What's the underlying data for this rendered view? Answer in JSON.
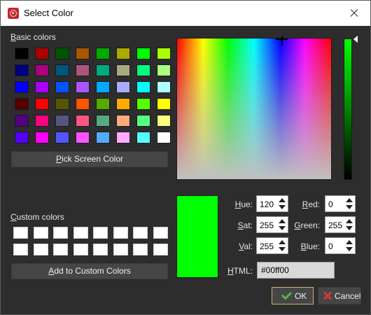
{
  "window": {
    "title": "Select Color"
  },
  "basic_colors": {
    "label": "Basic colors",
    "swatches": [
      [
        "#000000",
        "#aa0000",
        "#005500",
        "#aa5500",
        "#00aa00",
        "#aaaa00",
        "#00ff00",
        "#aaff00"
      ],
      [
        "#00007f",
        "#aa007f",
        "#00557f",
        "#aa557f",
        "#00aa7f",
        "#aaaa7f",
        "#00ff7f",
        "#aaff7f"
      ],
      [
        "#0000ff",
        "#aa00ff",
        "#0055ff",
        "#aa55ff",
        "#00aaff",
        "#aaaaff",
        "#00ffff",
        "#aaffff"
      ],
      [
        "#550000",
        "#ff0000",
        "#555500",
        "#ff5500",
        "#55aa00",
        "#ffaa00",
        "#55ff00",
        "#ffff00"
      ],
      [
        "#55007f",
        "#ff007f",
        "#55557f",
        "#ff557f",
        "#55aa7f",
        "#ffaa7f",
        "#55ff7f",
        "#ffff7f"
      ],
      [
        "#5500ff",
        "#ff00ff",
        "#5555ff",
        "#ff55ff",
        "#55aaff",
        "#ffaaff",
        "#55ffff",
        "#ffffff"
      ]
    ]
  },
  "pick_screen_color_label": "Pick Screen Color",
  "custom_colors": {
    "label": "Custom colors",
    "swatches": [
      [
        "#ffffff",
        "#ffffff",
        "#ffffff",
        "#ffffff",
        "#ffffff",
        "#ffffff",
        "#ffffff",
        "#ffffff"
      ],
      [
        "#ffffff",
        "#ffffff",
        "#ffffff",
        "#ffffff",
        "#ffffff",
        "#ffffff",
        "#ffffff",
        "#ffffff"
      ]
    ]
  },
  "add_custom_label": "Add to Custom Colors",
  "fields": {
    "hue": {
      "label": "Hue:",
      "value": "120"
    },
    "sat": {
      "label": "Sat:",
      "value": "255"
    },
    "val": {
      "label": "Val:",
      "value": "255"
    },
    "red": {
      "label": "Red:",
      "value": "0"
    },
    "green": {
      "label": "Green:",
      "value": "255"
    },
    "blue": {
      "label": "Blue:",
      "value": "0"
    },
    "html": {
      "label": "HTML:",
      "value": "#00ff00"
    }
  },
  "current_color": "#00ff00",
  "buttons": {
    "ok": "OK",
    "cancel": "Cancel"
  },
  "icons": {
    "app": "color-app-icon",
    "close": "close-icon",
    "ok": "check-icon",
    "cancel": "cancel-x-icon"
  }
}
